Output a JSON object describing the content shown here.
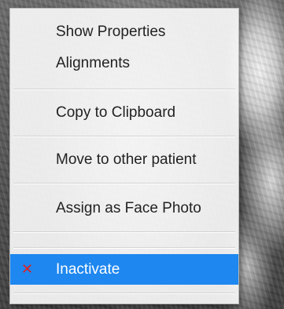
{
  "context_menu": {
    "items": [
      {
        "label": "Show Properties"
      },
      {
        "label": "Alignments"
      },
      {
        "label": "Copy to Clipboard"
      },
      {
        "label": "Move to other patient"
      },
      {
        "label": "Assign as Face Photo"
      },
      {
        "label": "Inactivate",
        "icon": "close-icon",
        "icon_glyph": "✕",
        "icon_color": "#e02020",
        "selected": true
      }
    ],
    "selection_color": "#1e87f0"
  }
}
